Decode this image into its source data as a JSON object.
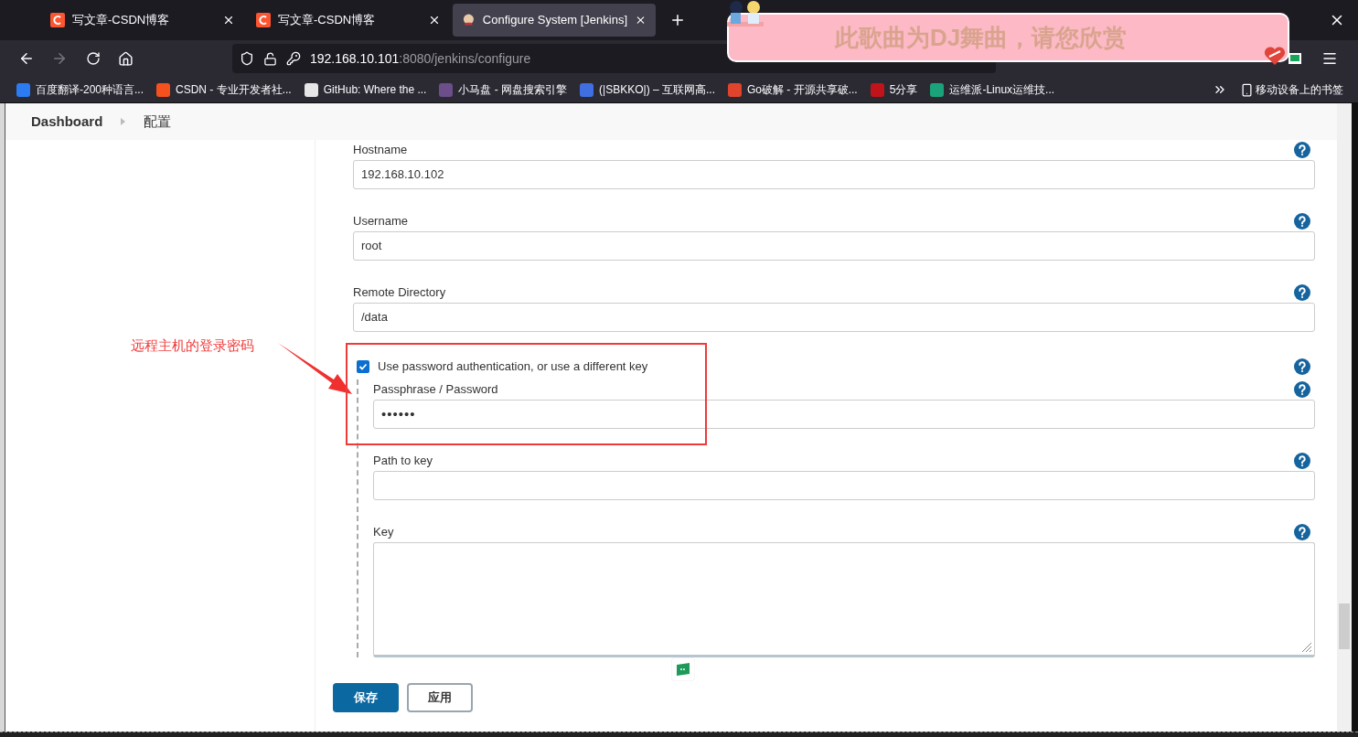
{
  "browser": {
    "tabs": [
      {
        "title": "写文章-CSDN博客",
        "kind": "csdn",
        "selected": false
      },
      {
        "title": "写文章-CSDN博客",
        "kind": "csdn",
        "selected": false
      },
      {
        "title": "Configure System [Jenkins]",
        "kind": "jenkins",
        "selected": true
      }
    ],
    "url": {
      "host": "192.168.10.101",
      "path": ":8080/jenkins/configure"
    },
    "bookmarks": [
      {
        "title": "百度翻译-200种语言...",
        "color": "#2b7bf2"
      },
      {
        "title": "CSDN - 专业开发者社...",
        "color": "#f4511e"
      },
      {
        "title": "GitHub: Where the ...",
        "color": "#e6e6e6"
      },
      {
        "title": "小马盘 - 网盘搜索引擎",
        "color": "#6b4e8a"
      },
      {
        "title": "(|SBKKO|) – 互联网高...",
        "color": "#3f6fe0"
      },
      {
        "title": "Go破解 - 开源共享破...",
        "color": "#e0442c"
      },
      {
        "title": "5分享",
        "color": "#c0141a"
      },
      {
        "title": "运维派-Linux运维技...",
        "color": "#1aa37a"
      }
    ],
    "mobile_bookmarks": "移动设备上的书签"
  },
  "overlay_banner": {
    "text": "此歌曲为DJ舞曲，请您欣赏"
  },
  "breadcrumb": [
    "Dashboard",
    "配置"
  ],
  "form": {
    "fields": [
      {
        "label": "Hostname",
        "value": "192.168.10.102",
        "kind": "text"
      },
      {
        "label": "Username",
        "value": "root",
        "kind": "text"
      },
      {
        "label": "Remote Directory",
        "value": "/data",
        "kind": "text"
      }
    ],
    "option": {
      "label": "Use password authentication, or use a different key",
      "checked": true
    },
    "sub_fields": [
      {
        "label": "Passphrase / Password",
        "value": "••••••",
        "kind": "password"
      },
      {
        "label": "Path to key",
        "kind": "text"
      },
      {
        "label": "Key",
        "kind": "textarea"
      }
    ]
  },
  "buttons": [
    {
      "label": "保存",
      "kind": "primary"
    },
    {
      "label": "应用",
      "kind": "secondary"
    }
  ],
  "annotation": {
    "text": "远程主机的登录密码"
  }
}
